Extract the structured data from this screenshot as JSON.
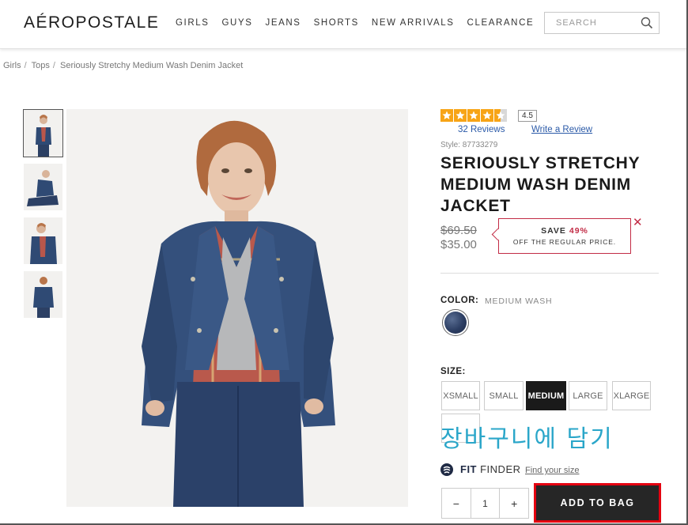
{
  "header": {
    "logo": "AÉROPOSTALE",
    "nav": [
      "GIRLS",
      "GUYS",
      "JEANS",
      "SHORTS",
      "NEW ARRIVALS",
      "CLEARANCE"
    ],
    "search_placeholder": "SEARCH"
  },
  "breadcrumb": {
    "items": [
      "Girls",
      "Tops",
      "Seriously Stretchy Medium Wash Denim Jacket"
    ]
  },
  "product": {
    "rating": "4.5",
    "reviews": "32 Reviews",
    "write_review": "Write a Review",
    "style": "Style: 87733279",
    "title": "SERIOUSLY STRETCHY MEDIUM WASH DENIM JACKET",
    "price_old": "$69.50",
    "price_new": "$35.00",
    "save": {
      "prefix": "SAVE",
      "percent": "49%",
      "line2": "OFF THE REGULAR PRICE.",
      "close": "✕"
    },
    "color_label": "COLOR:",
    "color_value": "MEDIUM WASH",
    "size_label": "SIZE:",
    "sizes": [
      "XSMALL",
      "SMALL",
      "MEDIUM",
      "LARGE",
      "XLARGE"
    ],
    "selected_size": "MEDIUM",
    "korean_annotation": "장바구니에 담기",
    "fit_finder_bold": "FIT",
    "fit_finder_rest": " FINDER",
    "find_size": "Find your size",
    "quantity": {
      "minus": "−",
      "value": "1",
      "plus": "+"
    },
    "add_to_bag": "ADD TO BAG"
  },
  "colors": {
    "accent_red": "#c22b45",
    "highlight_border": "#e40010",
    "star": "#f7a416",
    "link": "#2b5aa8",
    "annotation": "#2aa6c9"
  }
}
